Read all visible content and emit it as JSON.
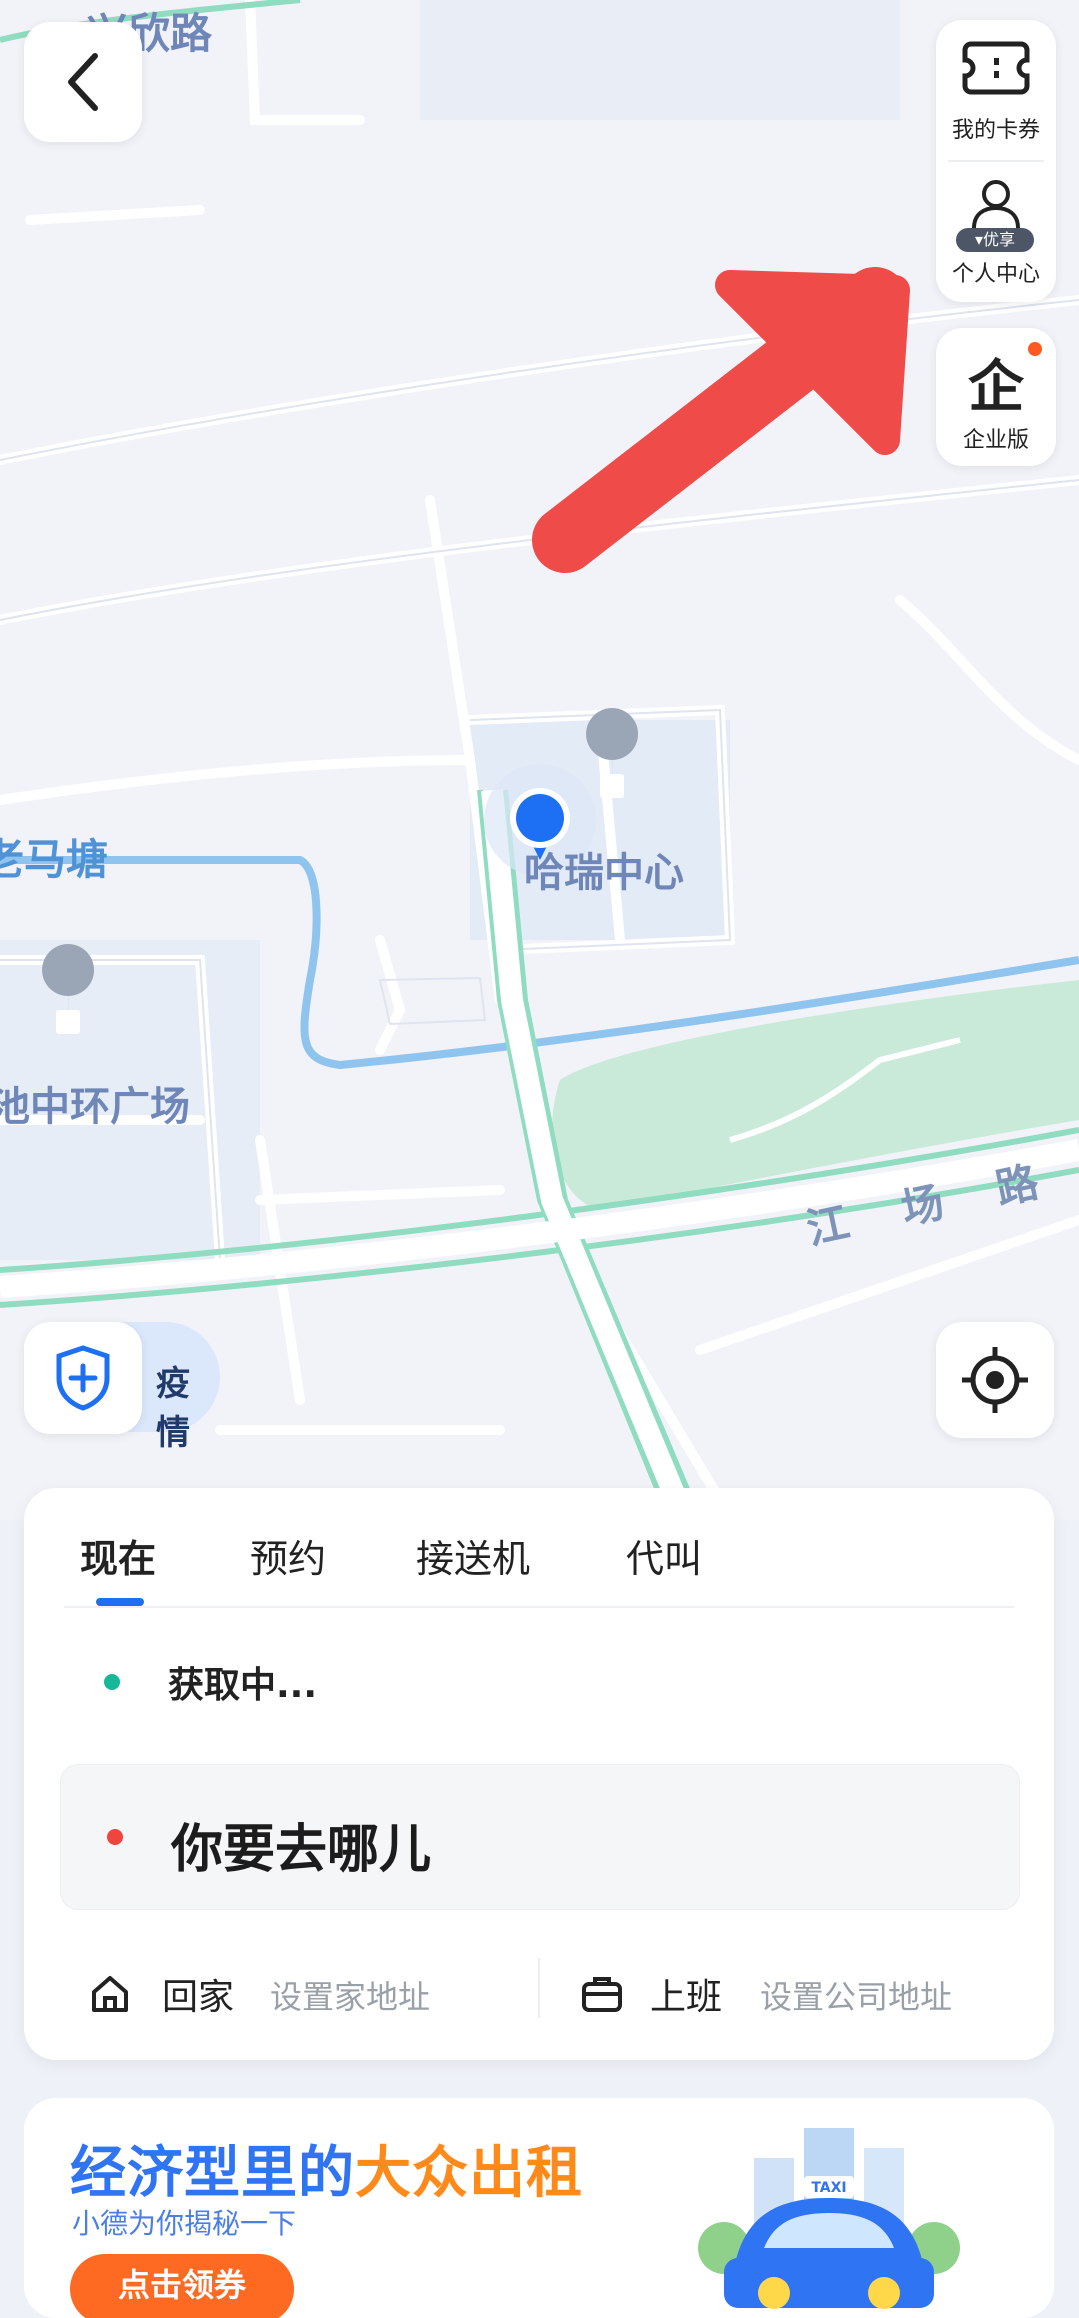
{
  "map": {
    "labels": {
      "road_top": "兴欣路",
      "road_left": "老马塘",
      "poi_center": "哈瑞中心",
      "poi_left": "池中环广场",
      "road_jiang": "江 场 路"
    }
  },
  "top_right": {
    "coupons_label": "我的卡券",
    "profile_label": "个人中心",
    "profile_badge": "优享",
    "enterprise_label": "企业版"
  },
  "epidemic_label": "疫情",
  "ride": {
    "tabs": [
      "现在",
      "预约",
      "接送机",
      "代叫"
    ],
    "from_text": "获取中...",
    "destination_placeholder": "你要去哪儿",
    "home_label": "回家",
    "home_hint": "设置家地址",
    "work_label": "上班",
    "work_hint": "设置公司地址"
  },
  "banner": {
    "title_part1": "经济型里的",
    "title_part2": "大众出租",
    "subtitle": "小德为你揭秘一下",
    "button": "点击领券",
    "taxi_sign": "TAXI"
  },
  "colors": {
    "accent_blue": "#1d6ff3",
    "from_dot": "#17b897",
    "to_dot": "#f0453f",
    "arrow_red": "#ef4b48",
    "banner_orange": "#ff6a22"
  }
}
